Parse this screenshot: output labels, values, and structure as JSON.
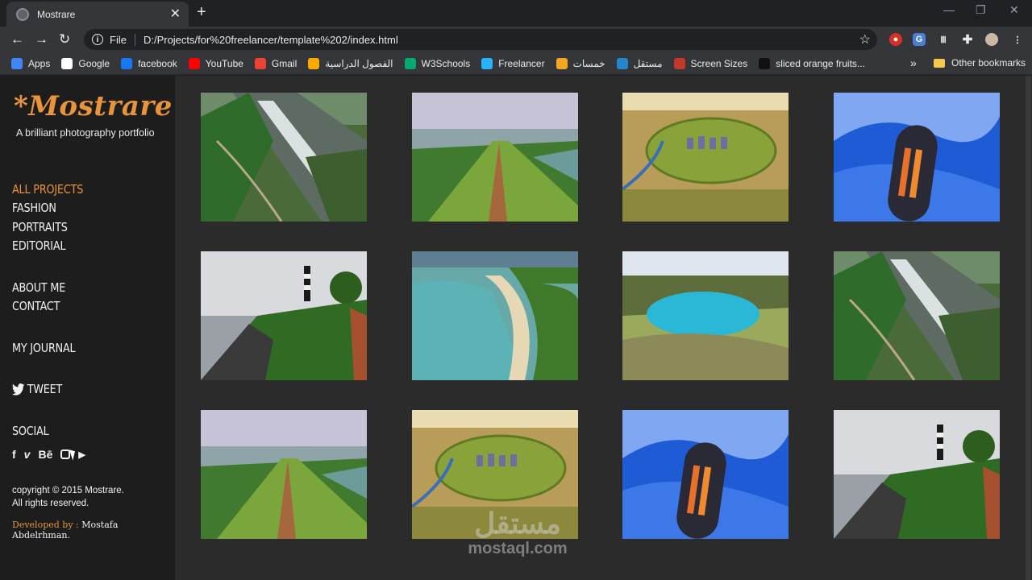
{
  "browser": {
    "tab_title": "Mostrare",
    "scheme": "File",
    "url": "D:/Projects/for%20freelancer/template%202/index.html",
    "bookmarks": [
      {
        "label": "Apps",
        "icon": "apps-grid-icon",
        "color": "#4285f4"
      },
      {
        "label": "Google",
        "icon": "google-icon",
        "color": "#ffffff"
      },
      {
        "label": "facebook",
        "icon": "facebook-icon",
        "color": "#1877f2"
      },
      {
        "label": "YouTube",
        "icon": "youtube-icon",
        "color": "#ff0000"
      },
      {
        "label": "Gmail",
        "icon": "gmail-icon",
        "color": "#ea4335"
      },
      {
        "label": "الفصول الدراسية",
        "icon": "classroom-icon",
        "color": "#f9ab00"
      },
      {
        "label": "W3Schools",
        "icon": "w3schools-icon",
        "color": "#04aa6d"
      },
      {
        "label": "Freelancer",
        "icon": "freelancer-icon",
        "color": "#29b2fe"
      },
      {
        "label": "خمسات",
        "icon": "khamsat-icon",
        "color": "#f5a623"
      },
      {
        "label": "مستقل",
        "icon": "mostaql-icon",
        "color": "#2386c8"
      },
      {
        "label": "Screen Sizes",
        "icon": "screen-sizes-icon",
        "color": "#c0392b"
      },
      {
        "label": "sliced orange fruits...",
        "icon": "unsplash-icon",
        "color": "#111111"
      }
    ],
    "other_bookmarks": "Other bookmarks"
  },
  "site": {
    "logo": "*Mostrare",
    "tagline": "A brilliant photography portfolio",
    "nav": [
      {
        "label": "ALL PROJECTS",
        "active": true
      },
      {
        "label": "FASHION"
      },
      {
        "label": "PORTRAITS"
      },
      {
        "label": "EDITORIAL"
      },
      {
        "label": "ABOUT ME"
      },
      {
        "label": "CONTACT"
      },
      {
        "label": "MY JOURNAL"
      },
      {
        "label": "TWEET"
      },
      {
        "label": "SOCIAL"
      }
    ],
    "social": [
      {
        "icon": "facebook-icon",
        "glyph": "f"
      },
      {
        "icon": "vimeo-icon",
        "glyph": "v"
      },
      {
        "icon": "behance-icon",
        "glyph": "Bē"
      },
      {
        "icon": "instagram-icon",
        "glyph": ""
      },
      {
        "icon": "youtube-icon",
        "glyph": "▶"
      }
    ],
    "copyright_line1": "copyright © 2015 Mostrare.",
    "copyright_line2": "All rights reserved.",
    "developed_by_label": "Developed by : ",
    "developer_name": "Mostafa Abdelrhman."
  },
  "gallery": [
    {
      "subject": "waterfall"
    },
    {
      "subject": "ridge"
    },
    {
      "subject": "stones"
    },
    {
      "subject": "capsule"
    },
    {
      "subject": "lighthouse"
    },
    {
      "subject": "beach"
    },
    {
      "subject": "lake"
    },
    {
      "subject": "waterfall"
    },
    {
      "subject": "ridge"
    },
    {
      "subject": "stones"
    },
    {
      "subject": "capsule"
    },
    {
      "subject": "lighthouse"
    }
  ],
  "watermark": {
    "arabic": "مستقل",
    "latin": "mostaql.com"
  },
  "colors": {
    "accent": "#e8943a",
    "sidebar": "#1d1d1d",
    "content": "#2b2b2b"
  }
}
